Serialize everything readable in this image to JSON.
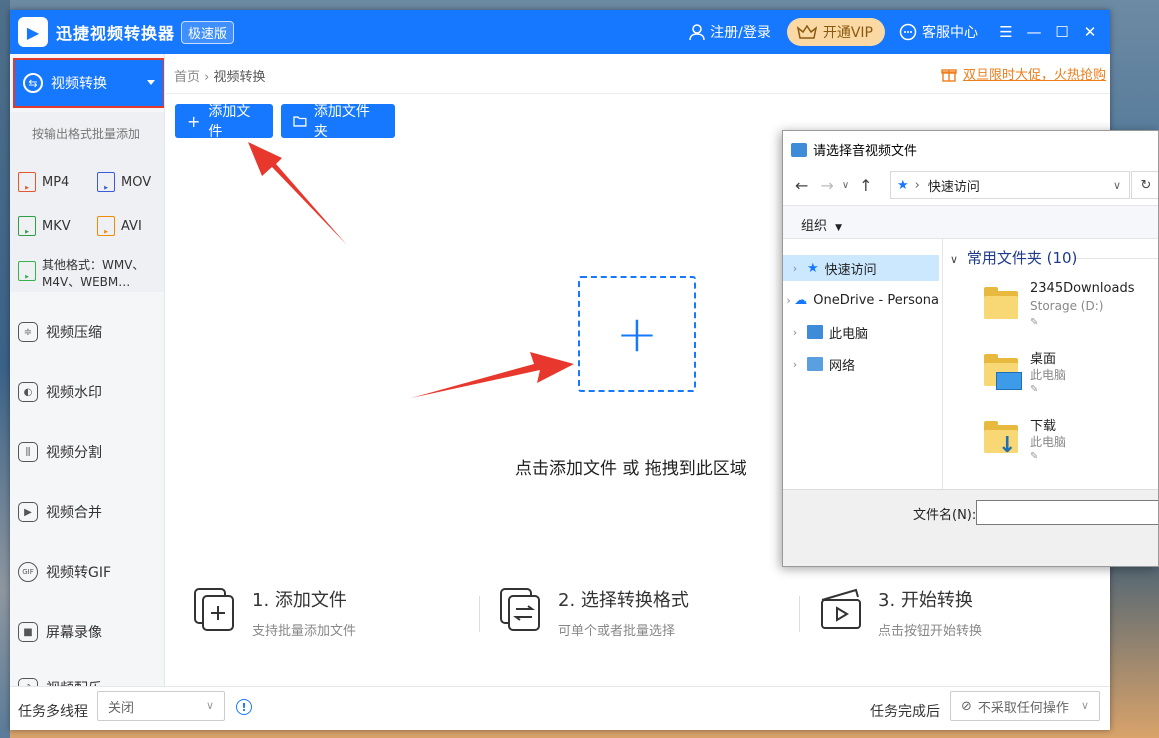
{
  "app": {
    "title": "迅捷视频转换器",
    "edition": "极速版",
    "login": "注册/登录",
    "vip": "开通VIP",
    "support": "客服中心",
    "accent": "#1677ff"
  },
  "sidebar": {
    "active": "视频转换",
    "hint": "按输出格式批量添加",
    "formats": [
      "MP4",
      "MOV",
      "MKV",
      "AVI"
    ],
    "other_formats": [
      "其他格式：WMV、",
      "M4V、WEBM…"
    ],
    "items": [
      {
        "label": "视频压缩",
        "icon": "compress-icon"
      },
      {
        "label": "视频水印",
        "icon": "watermark-icon"
      },
      {
        "label": "视频分割",
        "icon": "split-icon"
      },
      {
        "label": "视频合并",
        "icon": "merge-icon"
      },
      {
        "label": "视频转GIF",
        "icon": "gif-icon"
      },
      {
        "label": "屏幕录像",
        "icon": "screen-record-icon"
      },
      {
        "label": "视频配乐",
        "icon": "music-icon"
      }
    ]
  },
  "main": {
    "breadcrumb_home": "首页",
    "breadcrumb_current": "视频转换",
    "promo": "双旦限时大促，火热抢购",
    "add_file": "添加文件",
    "add_folder": "添加文件夹",
    "drop_text": "点击添加文件 或 拖拽到此区域",
    "steps": [
      {
        "title": "1. 添加文件",
        "sub": "支持批量添加文件"
      },
      {
        "title": "2. 选择转换格式",
        "sub": "可单个或者批量选择"
      },
      {
        "title": "3. 开始转换",
        "sub": "点击按钮开始转换"
      }
    ]
  },
  "footer": {
    "thread_label": "任务多线程",
    "thread_value": "关闭",
    "after_label": "任务完成后",
    "after_value": "不采取任何操作"
  },
  "dialog": {
    "title": "请选择音视频文件",
    "address": "快速访问",
    "organize": "组织",
    "nav": [
      "快速访问",
      "OneDrive - Persona",
      "此电脑",
      "网络"
    ],
    "group": "常用文件夹 (10)",
    "folders": [
      {
        "name": "2345Downloads",
        "sub": "Storage (D:)"
      },
      {
        "name": "桌面",
        "sub": "此电脑"
      },
      {
        "name": "下载",
        "sub": "此电脑"
      }
    ],
    "filename_label": "文件名(N):"
  }
}
